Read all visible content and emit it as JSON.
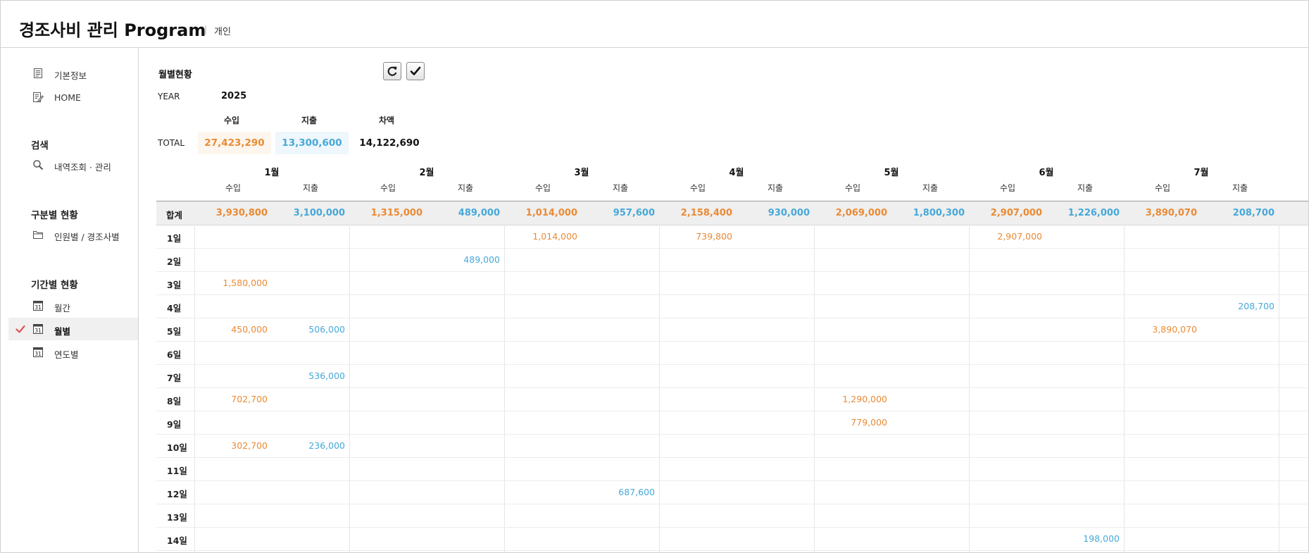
{
  "app": {
    "title": "경조사비 관리 Program",
    "separator": "|",
    "subtitle": "개인"
  },
  "colors": {
    "income": "#ea8a34",
    "expense": "#47a8d8",
    "balance": "#111111",
    "active_check": "#e05252"
  },
  "sidebar": {
    "top_items": [
      {
        "label": "기본정보",
        "icon": "document-icon"
      },
      {
        "label": "HOME",
        "icon": "edit-document-icon"
      }
    ],
    "search_section": {
      "title": "검색",
      "items": [
        {
          "label": "내역조회 · 관리",
          "icon": "search-icon"
        }
      ]
    },
    "category_section": {
      "title": "구분별 현황",
      "items": [
        {
          "label": "인원별 / 경조사별",
          "icon": "folder-icon"
        }
      ]
    },
    "period_section": {
      "title": "기간별 현황",
      "items": [
        {
          "label": "월간",
          "icon": "calendar-icon",
          "calendar_day": "31",
          "active": false
        },
        {
          "label": "월별",
          "icon": "calendar-icon",
          "calendar_day": "31",
          "active": true
        },
        {
          "label": "연도별",
          "icon": "calendar-icon",
          "calendar_day": "31",
          "active": false
        }
      ]
    }
  },
  "main": {
    "title": "월별현황",
    "toolbar": {
      "refresh_icon": "refresh-icon",
      "confirm_icon": "check-icon"
    },
    "year": {
      "label": "YEAR",
      "value": "2025"
    },
    "summary": {
      "headers": {
        "income": "수입",
        "expense": "지출",
        "balance": "차액"
      },
      "total_label": "TOTAL",
      "income": "27,423,290",
      "expense": "13,300,600",
      "balance": "14,122,690"
    },
    "table": {
      "sum_label": "합계",
      "sub_headers": {
        "income": "수입",
        "expense": "지출"
      },
      "months": [
        {
          "label": "1월",
          "income_total": "3,930,800",
          "expense_total": "3,100,000"
        },
        {
          "label": "2월",
          "income_total": "1,315,000",
          "expense_total": "489,000"
        },
        {
          "label": "3월",
          "income_total": "1,014,000",
          "expense_total": "957,600"
        },
        {
          "label": "4월",
          "income_total": "2,158,400",
          "expense_total": "930,000"
        },
        {
          "label": "5월",
          "income_total": "2,069,000",
          "expense_total": "1,800,300"
        },
        {
          "label": "6월",
          "income_total": "2,907,000",
          "expense_total": "1,226,000"
        },
        {
          "label": "7월",
          "income_total": "3,890,070",
          "expense_total": "208,700"
        }
      ],
      "rows": [
        {
          "day": "1일",
          "cells": [
            [
              "",
              ""
            ],
            [
              "",
              ""
            ],
            [
              "1,014,000",
              ""
            ],
            [
              "739,800",
              ""
            ],
            [
              "",
              ""
            ],
            [
              "2,907,000",
              ""
            ],
            [
              "",
              ""
            ]
          ]
        },
        {
          "day": "2일",
          "cells": [
            [
              "",
              ""
            ],
            [
              "",
              "489,000"
            ],
            [
              "",
              ""
            ],
            [
              "",
              ""
            ],
            [
              "",
              ""
            ],
            [
              "",
              ""
            ],
            [
              "",
              ""
            ]
          ]
        },
        {
          "day": "3일",
          "cells": [
            [
              "1,580,000",
              ""
            ],
            [
              "",
              ""
            ],
            [
              "",
              ""
            ],
            [
              "",
              ""
            ],
            [
              "",
              ""
            ],
            [
              "",
              ""
            ],
            [
              "",
              ""
            ]
          ]
        },
        {
          "day": "4일",
          "cells": [
            [
              "",
              ""
            ],
            [
              "",
              ""
            ],
            [
              "",
              ""
            ],
            [
              "",
              ""
            ],
            [
              "",
              ""
            ],
            [
              "",
              ""
            ],
            [
              "",
              "208,700"
            ]
          ]
        },
        {
          "day": "5일",
          "cells": [
            [
              "450,000",
              "506,000"
            ],
            [
              "",
              ""
            ],
            [
              "",
              ""
            ],
            [
              "",
              ""
            ],
            [
              "",
              ""
            ],
            [
              "",
              ""
            ],
            [
              "3,890,070",
              ""
            ]
          ]
        },
        {
          "day": "6일",
          "cells": [
            [
              "",
              ""
            ],
            [
              "",
              ""
            ],
            [
              "",
              ""
            ],
            [
              "",
              ""
            ],
            [
              "",
              ""
            ],
            [
              "",
              ""
            ],
            [
              "",
              ""
            ]
          ]
        },
        {
          "day": "7일",
          "cells": [
            [
              "",
              "536,000"
            ],
            [
              "",
              ""
            ],
            [
              "",
              ""
            ],
            [
              "",
              ""
            ],
            [
              "",
              ""
            ],
            [
              "",
              ""
            ],
            [
              "",
              ""
            ]
          ]
        },
        {
          "day": "8일",
          "cells": [
            [
              "702,700",
              ""
            ],
            [
              "",
              ""
            ],
            [
              "",
              ""
            ],
            [
              "",
              ""
            ],
            [
              "1,290,000",
              ""
            ],
            [
              "",
              ""
            ],
            [
              "",
              ""
            ]
          ]
        },
        {
          "day": "9일",
          "cells": [
            [
              "",
              ""
            ],
            [
              "",
              ""
            ],
            [
              "",
              ""
            ],
            [
              "",
              ""
            ],
            [
              "779,000",
              ""
            ],
            [
              "",
              ""
            ],
            [
              "",
              ""
            ]
          ]
        },
        {
          "day": "10일",
          "cells": [
            [
              "302,700",
              "236,000"
            ],
            [
              "",
              ""
            ],
            [
              "",
              ""
            ],
            [
              "",
              ""
            ],
            [
              "",
              ""
            ],
            [
              "",
              ""
            ],
            [
              "",
              ""
            ]
          ]
        },
        {
          "day": "11일",
          "cells": [
            [
              "",
              ""
            ],
            [
              "",
              ""
            ],
            [
              "",
              ""
            ],
            [
              "",
              ""
            ],
            [
              "",
              ""
            ],
            [
              "",
              ""
            ],
            [
              "",
              ""
            ]
          ]
        },
        {
          "day": "12일",
          "cells": [
            [
              "",
              ""
            ],
            [
              "",
              ""
            ],
            [
              "",
              "687,600"
            ],
            [
              "",
              ""
            ],
            [
              "",
              ""
            ],
            [
              "",
              ""
            ],
            [
              "",
              ""
            ]
          ]
        },
        {
          "day": "13일",
          "cells": [
            [
              "",
              ""
            ],
            [
              "",
              ""
            ],
            [
              "",
              ""
            ],
            [
              "",
              ""
            ],
            [
              "",
              ""
            ],
            [
              "",
              ""
            ],
            [
              "",
              ""
            ]
          ]
        },
        {
          "day": "14일",
          "cells": [
            [
              "",
              ""
            ],
            [
              "",
              ""
            ],
            [
              "",
              ""
            ],
            [
              "",
              ""
            ],
            [
              "",
              ""
            ],
            [
              "",
              "198,000"
            ],
            [
              "",
              ""
            ]
          ]
        }
      ]
    }
  }
}
